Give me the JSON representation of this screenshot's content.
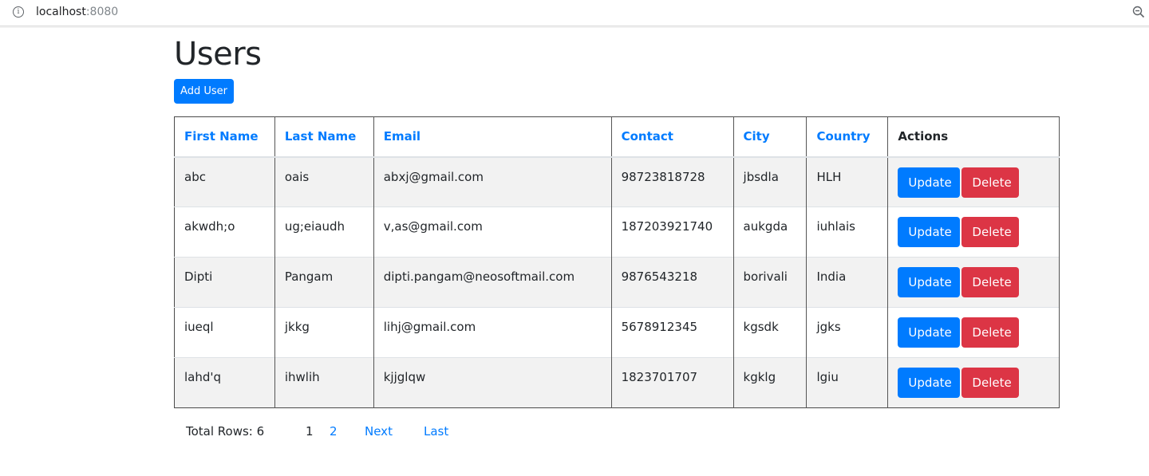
{
  "browser": {
    "url_host": "localhost",
    "url_port": ":8080",
    "info_icon": "info-icon",
    "zoom_icon": "zoom-out-icon"
  },
  "page": {
    "title": "Users",
    "add_user_label": "Add User"
  },
  "table": {
    "headers": [
      "First Name",
      "Last Name",
      "Email",
      "Contact",
      "City",
      "Country",
      "Actions"
    ],
    "rows": [
      {
        "first": "abc",
        "last": "oais",
        "email": "abxj@gmail.com",
        "contact": "98723818728",
        "city": "jbsdla",
        "country": "HLH"
      },
      {
        "first": "akwdh;o",
        "last": "ug;eiaudh",
        "email": "v,as@gmail.com",
        "contact": "187203921740",
        "city": "aukgda",
        "country": "iuhlais"
      },
      {
        "first": "Dipti",
        "last": "Pangam",
        "email": "dipti.pangam@neosoftmail.com",
        "contact": "9876543218",
        "city": "borivali",
        "country": "India"
      },
      {
        "first": "iueql",
        "last": "jkkg",
        "email": "lihj@gmail.com",
        "contact": "5678912345",
        "city": "kgsdk",
        "country": "jgks"
      },
      {
        "first": "lahd'q",
        "last": "ihwlih",
        "email": "kjjglqw",
        "contact": "1823701707",
        "city": "kgklg",
        "country": "lgiu"
      }
    ],
    "update_label": "Update",
    "delete_label": "Delete"
  },
  "pagination": {
    "total_rows": "Total Rows: 6",
    "pages": [
      "1",
      "2"
    ],
    "current_page": "1",
    "next_label": "Next",
    "last_label": "Last"
  },
  "colors": {
    "primary": "#007bff",
    "danger": "#dc3545",
    "stripe": "#f2f2f2"
  }
}
